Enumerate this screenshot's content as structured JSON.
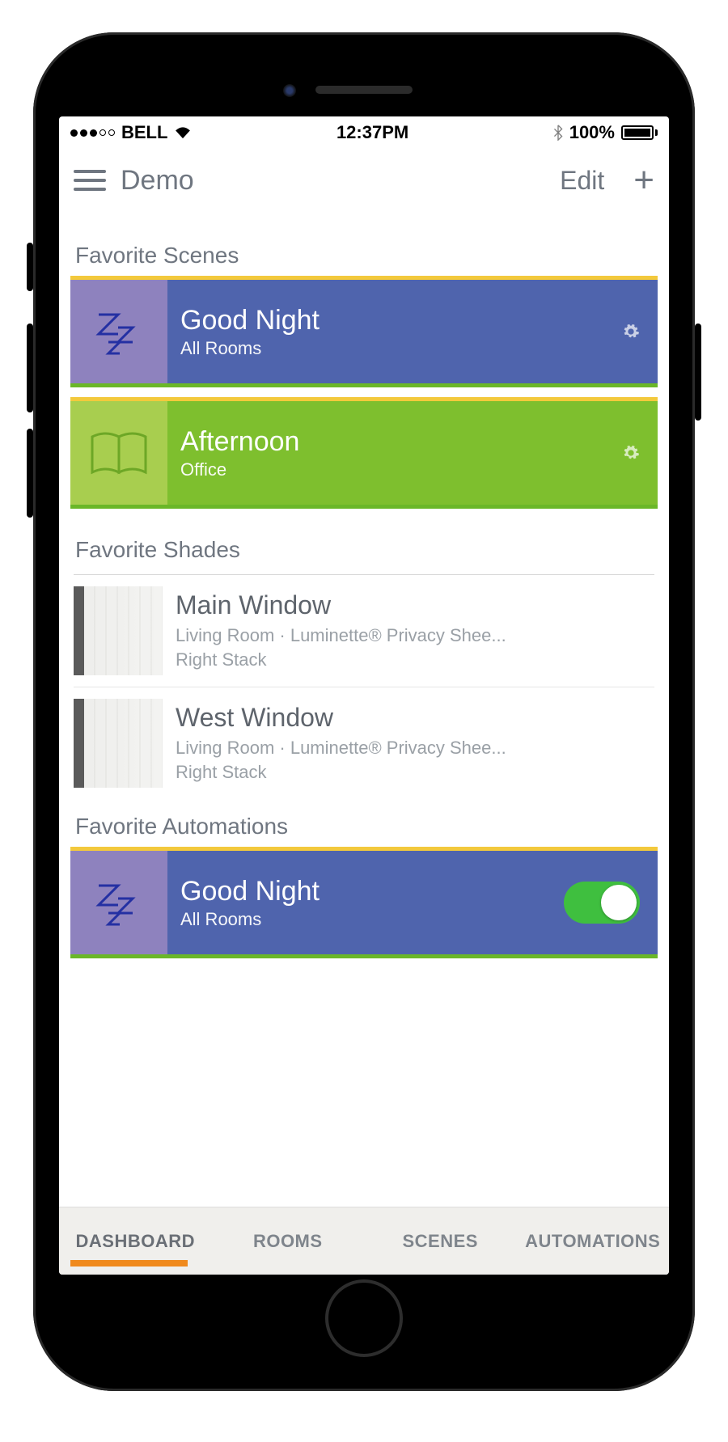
{
  "status": {
    "carrier": "BELL",
    "time": "12:37PM",
    "battery_pct": "100%"
  },
  "nav": {
    "title": "Demo",
    "edit_label": "Edit"
  },
  "sections": {
    "scenes_title": "Favorite Scenes",
    "shades_title": "Favorite Shades",
    "automations_title": "Favorite Automations"
  },
  "scenes": [
    {
      "title": "Good Night",
      "sub": "All Rooms",
      "icon": "sleep-zz",
      "variant": "blue"
    },
    {
      "title": "Afternoon",
      "sub": "Office",
      "icon": "book",
      "variant": "green"
    }
  ],
  "shades": [
    {
      "title": "Main Window",
      "line1": "Living Room · Luminette® Privacy Shee...",
      "line2": "Right Stack"
    },
    {
      "title": "West Window",
      "line1": "Living Room · Luminette® Privacy Shee...",
      "line2": "Right Stack"
    }
  ],
  "automations": [
    {
      "title": "Good Night",
      "sub": "All Rooms",
      "icon": "sleep-zz",
      "enabled": true
    }
  ],
  "tabs": [
    {
      "label": "DASHBOARD",
      "active": true
    },
    {
      "label": "ROOMS",
      "active": false
    },
    {
      "label": "SCENES",
      "active": false
    },
    {
      "label": "AUTOMATIONS",
      "active": false
    }
  ]
}
